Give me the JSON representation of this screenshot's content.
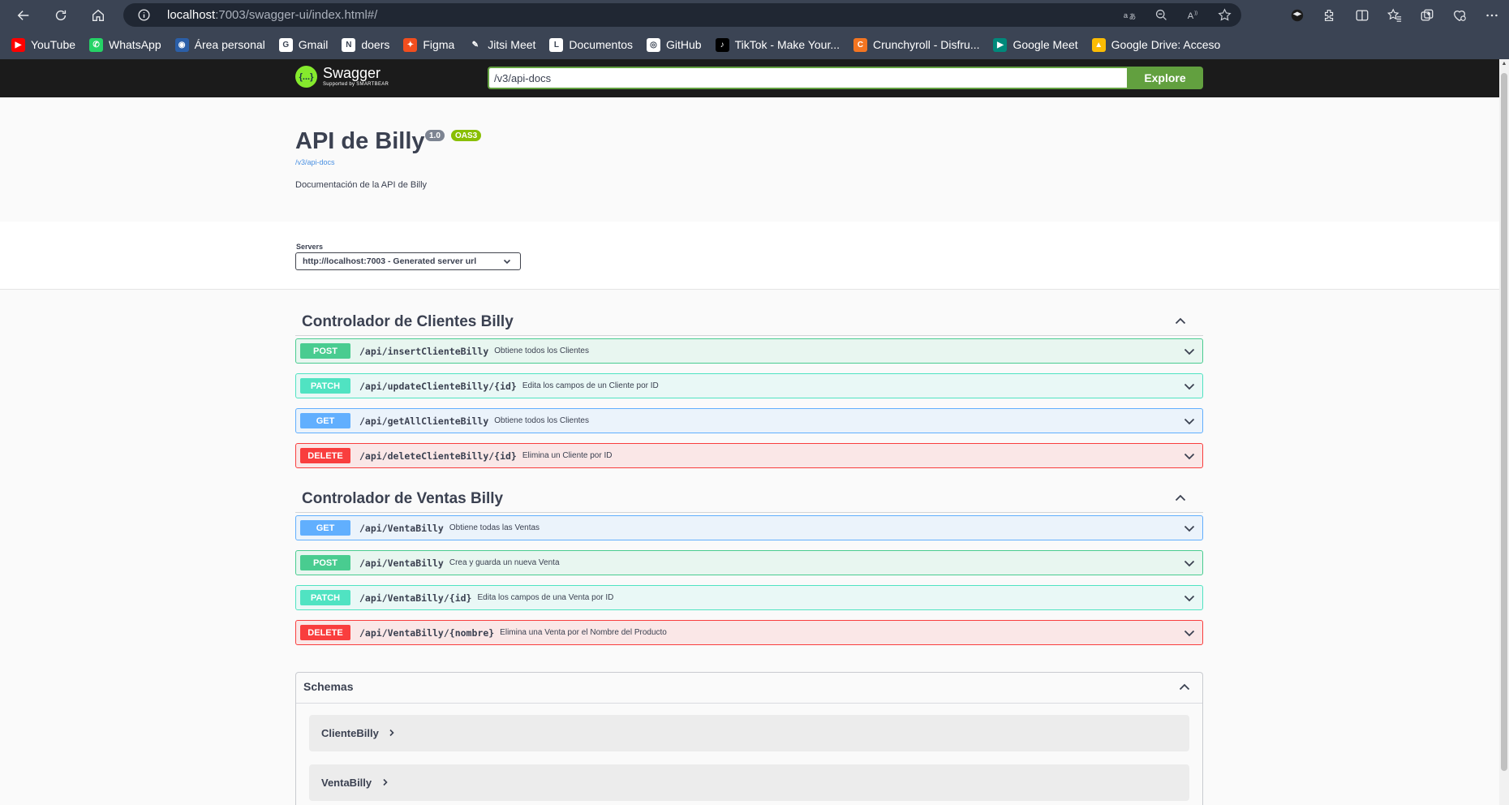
{
  "browser": {
    "url_host": "localhost",
    "url_path": ":7003/swagger-ui/index.html#/",
    "bookmarks": [
      {
        "label": "YouTube",
        "color": "#ff0000",
        "glyph": "▶"
      },
      {
        "label": "WhatsApp",
        "color": "#25d366",
        "glyph": "✆"
      },
      {
        "label": "Área personal",
        "color": "#2b5fa8",
        "glyph": "◉"
      },
      {
        "label": "Gmail",
        "color": "#ffffff",
        "glyph": "G"
      },
      {
        "label": "doers",
        "color": "#ffffff",
        "glyph": "N"
      },
      {
        "label": "Figma",
        "color": "#f24e1e",
        "glyph": "✦"
      },
      {
        "label": "Jitsi Meet",
        "color": "#3b4454",
        "glyph": "✎"
      },
      {
        "label": "Documentos",
        "color": "#ffffff",
        "glyph": "L"
      },
      {
        "label": "GitHub",
        "color": "#ffffff",
        "glyph": "◎"
      },
      {
        "label": "TikTok - Make Your...",
        "color": "#000000",
        "glyph": "♪"
      },
      {
        "label": "Crunchyroll - Disfru...",
        "color": "#f47521",
        "glyph": "C"
      },
      {
        "label": "Google Meet",
        "color": "#00897b",
        "glyph": "▶"
      },
      {
        "label": "Google Drive: Acceso",
        "color": "#fbbc04",
        "glyph": "▲"
      }
    ]
  },
  "topbar": {
    "logo_text": "Swagger",
    "logo_sub": "Supported by SMARTBEAR",
    "logo_mark": "{...}",
    "explore_value": "/v3/api-docs",
    "explore_label": "Explore"
  },
  "info": {
    "title": "API de Billy",
    "version": "1.0",
    "oas": "OAS3",
    "link": "/v3/api-docs",
    "description": "Documentación de la API de Billy"
  },
  "servers": {
    "label": "Servers",
    "selected": "http://localhost:7003 - Generated server url"
  },
  "tags": [
    {
      "title": "Controlador de Clientes Billy",
      "operations": [
        {
          "method": "POST",
          "path": "/api/insertClienteBilly",
          "summary": "Obtiene todos los Clientes"
        },
        {
          "method": "PATCH",
          "path": "/api/updateClienteBilly/{id}",
          "summary": "Edita los campos de un Cliente por ID"
        },
        {
          "method": "GET",
          "path": "/api/getAllClienteBilly",
          "summary": "Obtiene todos los Clientes"
        },
        {
          "method": "DELETE",
          "path": "/api/deleteClienteBilly/{id}",
          "summary": "Elimina un Cliente por ID"
        }
      ]
    },
    {
      "title": "Controlador de Ventas Billy",
      "operations": [
        {
          "method": "GET",
          "path": "/api/VentaBilly",
          "summary": "Obtiene todas las Ventas"
        },
        {
          "method": "POST",
          "path": "/api/VentaBilly",
          "summary": "Crea y guarda un nueva Venta"
        },
        {
          "method": "PATCH",
          "path": "/api/VentaBilly/{id}",
          "summary": "Edita los campos de una Venta por ID"
        },
        {
          "method": "DELETE",
          "path": "/api/VentaBilly/{nombre}",
          "summary": "Elimina una Venta por el Nombre del Producto"
        }
      ]
    }
  ],
  "schemas": {
    "title": "Schemas",
    "models": [
      "ClienteBilly",
      "VentaBilly"
    ]
  }
}
